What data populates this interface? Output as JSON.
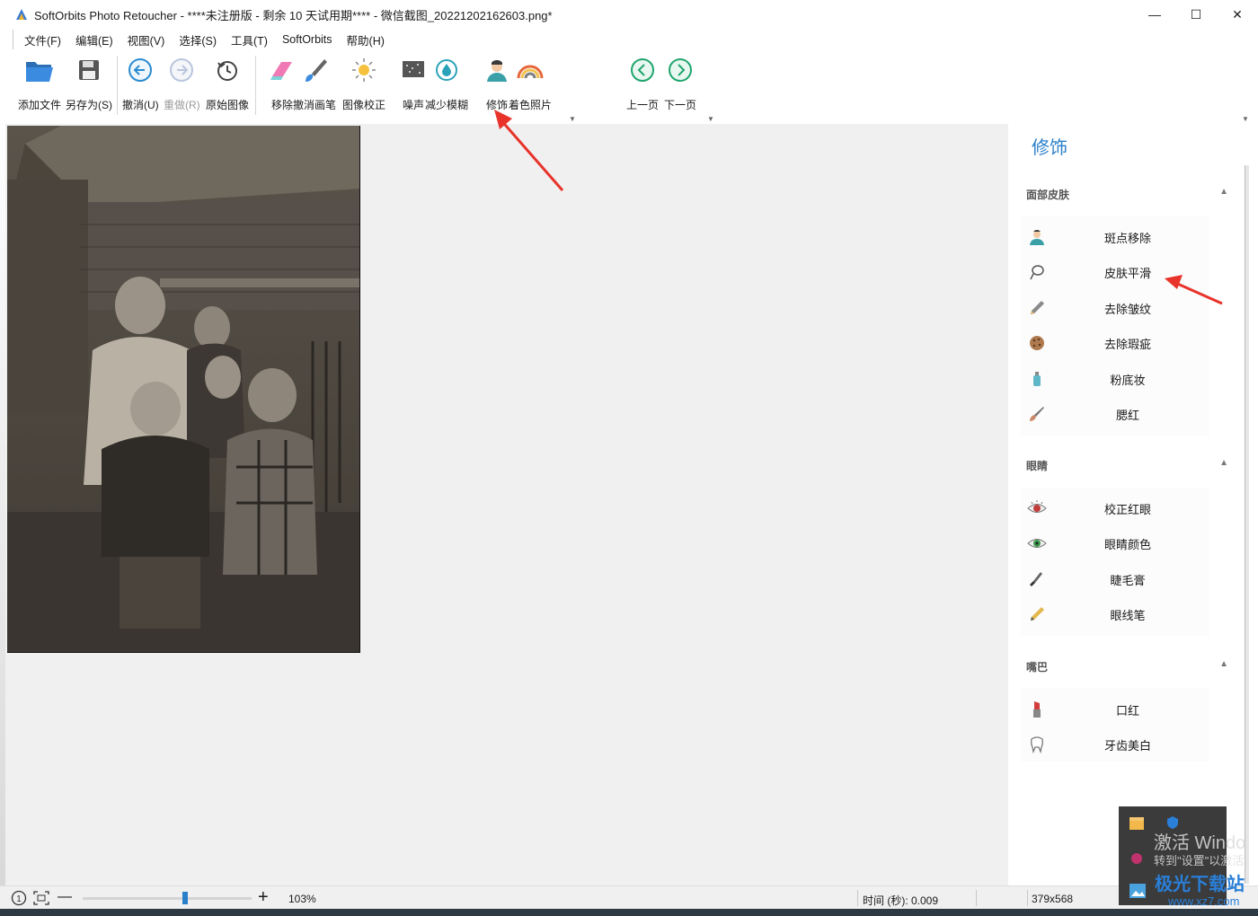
{
  "window": {
    "title": "SoftOrbits Photo Retoucher - ****未注册版 - 剩余 10 天试用期**** - 微信截图_20221202162603.png*",
    "minimize": "—",
    "maximize": "☐",
    "close": "✕"
  },
  "menu": [
    "文件(F)",
    "编辑(E)",
    "视图(V)",
    "选择(S)",
    "工具(T)",
    "SoftOrbits",
    "帮助(H)"
  ],
  "toolbar": {
    "add_file": "添加文件",
    "save_as": "另存为(S)",
    "undo": "撤消(U)",
    "redo": "重做(R)",
    "original": "原始图像",
    "remove": "移除",
    "undo_brush": "撤消画笔",
    "correction": "图像校正",
    "noise": "噪声",
    "reduce_blur": "减少模糊",
    "retouch": "修饰",
    "colorize": "着色照片",
    "prev_page": "上一页",
    "next_page": "下一页"
  },
  "panel": {
    "title": "修饰",
    "sections": [
      {
        "header": "面部皮肤",
        "items": [
          "斑点移除",
          "皮肤平滑",
          "去除皱纹",
          "去除瑕疵",
          "粉底妆",
          "腮红"
        ]
      },
      {
        "header": "眼睛",
        "items": [
          "校正红眼",
          "眼睛颜色",
          "睫毛膏",
          "眼线笔"
        ]
      },
      {
        "header": "嘴巴",
        "items": [
          "口红",
          "牙齿美白"
        ]
      }
    ]
  },
  "status": {
    "zoom": "103%",
    "time": "时间 (秒): 0.009",
    "size": "379x568"
  },
  "overlay": {
    "activate": "激活 Windo",
    "activate_sub": "转到\"设置\"以激活",
    "site": "极光下载站",
    "site_url": "www.xz7.com"
  },
  "colors": {
    "accent": "#2a7fc9",
    "arrow": "#e8332a"
  }
}
